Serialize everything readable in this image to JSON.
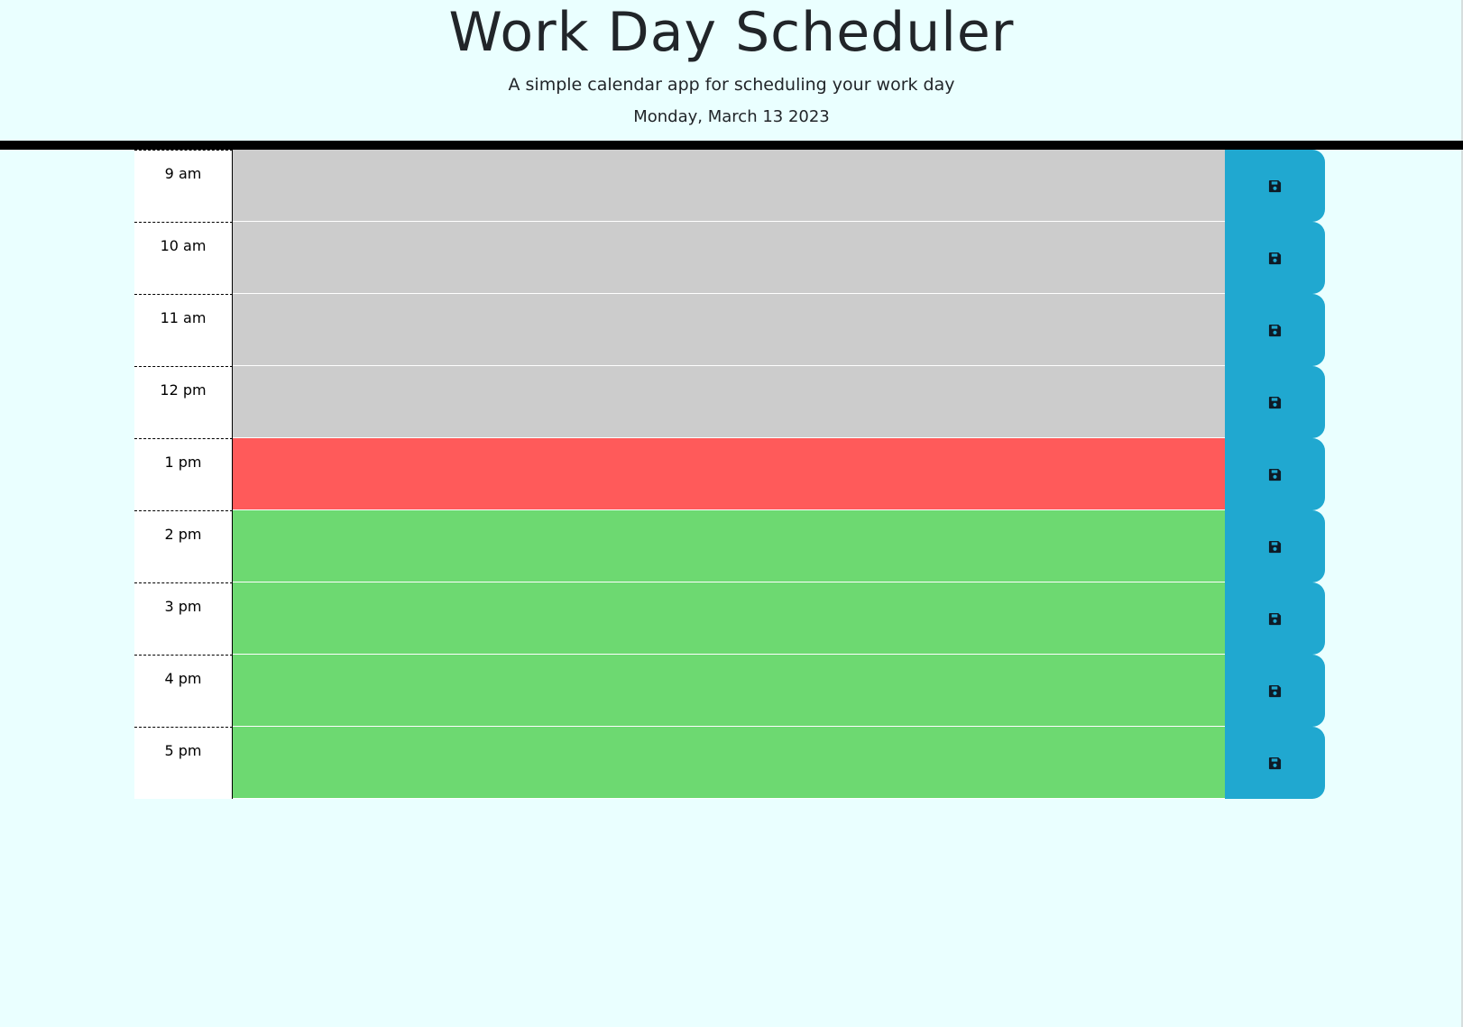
{
  "header": {
    "title": "Work Day Scheduler",
    "subtitle": "A simple calendar app for scheduling your work day",
    "current_day": "Monday, March 13 2023"
  },
  "schedule": {
    "status_colors": {
      "past": "#cccccc",
      "present": "#ff5a5a",
      "future": "#6dd971"
    },
    "save_button_color": "#20a8d0",
    "save_icon": "floppy-disk-icon",
    "blocks": [
      {
        "hour_label": "9 am",
        "status": "past",
        "text": ""
      },
      {
        "hour_label": "10 am",
        "status": "past",
        "text": ""
      },
      {
        "hour_label": "11 am",
        "status": "past",
        "text": ""
      },
      {
        "hour_label": "12 pm",
        "status": "past",
        "text": ""
      },
      {
        "hour_label": "1 pm",
        "status": "present",
        "text": ""
      },
      {
        "hour_label": "2 pm",
        "status": "future",
        "text": ""
      },
      {
        "hour_label": "3 pm",
        "status": "future",
        "text": ""
      },
      {
        "hour_label": "4 pm",
        "status": "future",
        "text": ""
      },
      {
        "hour_label": "5 pm",
        "status": "future",
        "text": ""
      }
    ]
  }
}
